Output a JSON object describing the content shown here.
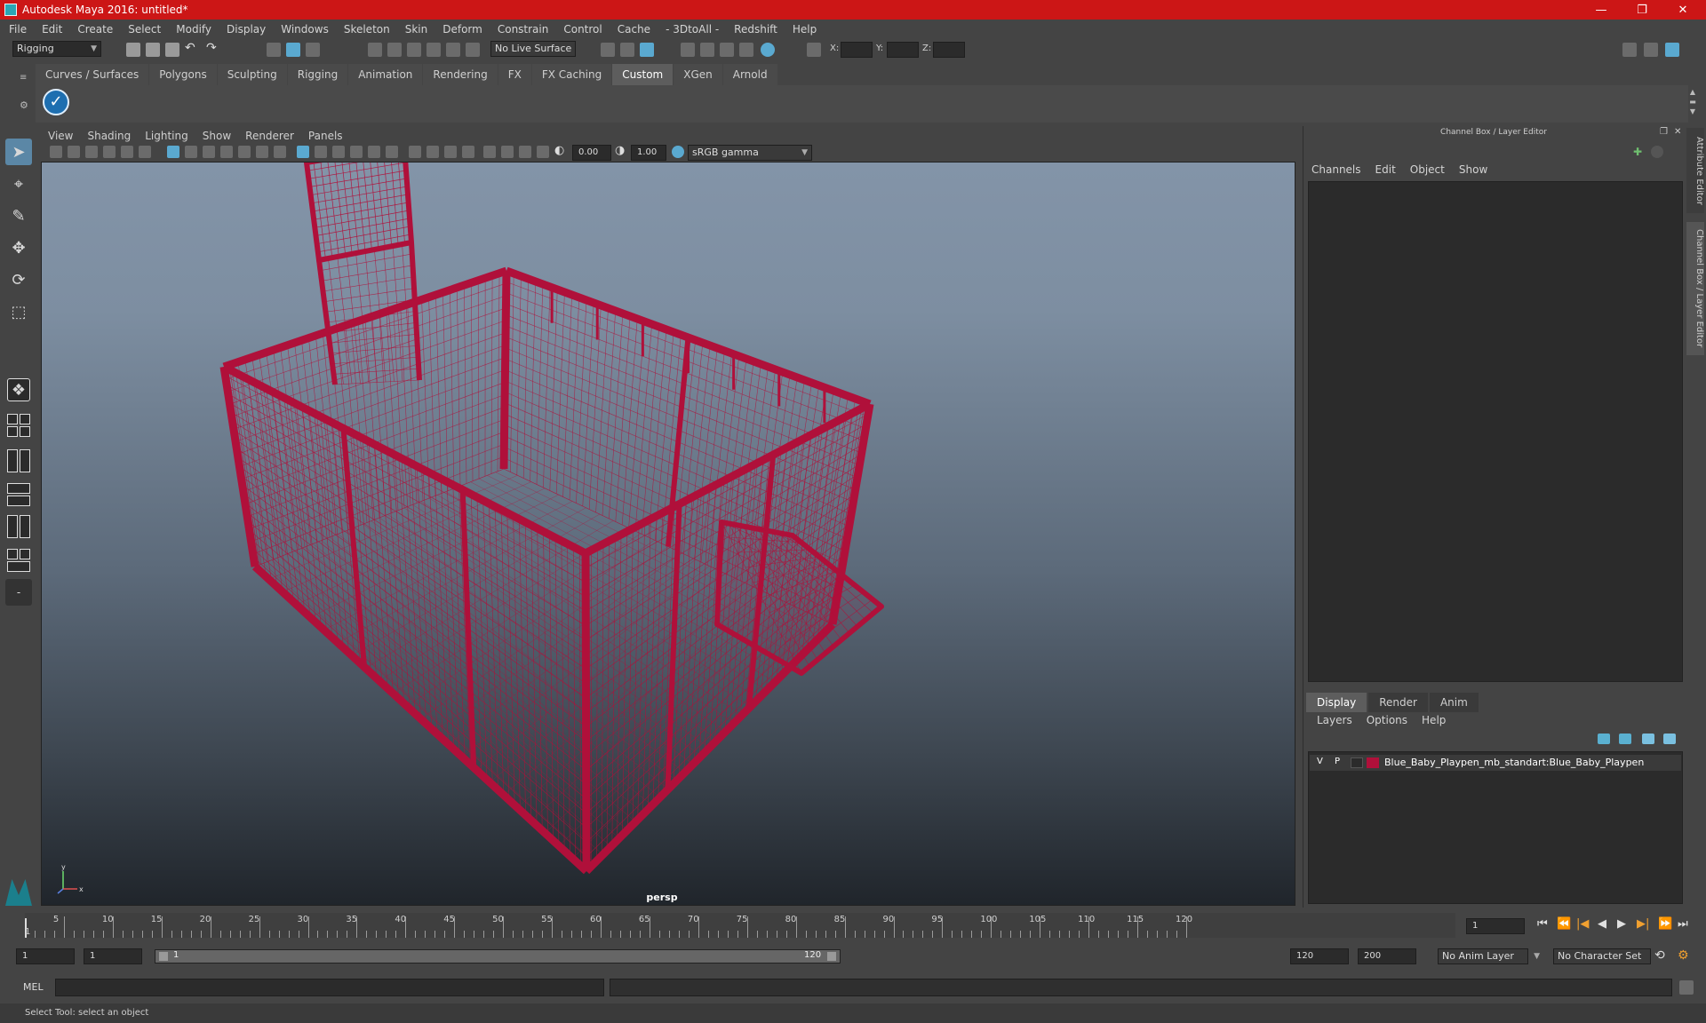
{
  "window": {
    "title": "Autodesk Maya 2016: untitled*",
    "minimize": "—",
    "maximize": "❐",
    "close": "✕"
  },
  "menubar": [
    "File",
    "Edit",
    "Create",
    "Select",
    "Modify",
    "Display",
    "Windows",
    "Skeleton",
    "Skin",
    "Deform",
    "Constrain",
    "Control",
    "Cache",
    "- 3DtoAll -",
    "Redshift",
    "Help"
  ],
  "statusline": {
    "menuset": "Rigging",
    "live_surface": "No Live Surface",
    "x_label": "X:",
    "y_label": "Y:",
    "z_label": "Z:"
  },
  "shelf": {
    "tabs": [
      "Curves / Surfaces",
      "Polygons",
      "Sculpting",
      "Rigging",
      "Animation",
      "Rendering",
      "FX",
      "FX Caching",
      "Custom",
      "XGen",
      "Arnold"
    ],
    "active_tab": "Custom",
    "button_icon": "checkmark-icon"
  },
  "viewport": {
    "menu": [
      "View",
      "Shading",
      "Lighting",
      "Show",
      "Renderer",
      "Panels"
    ],
    "exposure": "0.00",
    "gamma": "1.00",
    "color_space": "sRGB gamma",
    "camera": "persp",
    "wire_color": "#b0103a",
    "axis_x": "x",
    "axis_y": "y"
  },
  "right_panel": {
    "title": "Channel Box / Layer Editor",
    "side_tabs": [
      "Attribute Editor",
      "Channel Box / Layer Editor"
    ],
    "channel_menu": [
      "Channels",
      "Edit",
      "Object",
      "Show"
    ],
    "layer_tabs": [
      "Display",
      "Render",
      "Anim"
    ],
    "active_layer_tab": "Display",
    "layer_menu": [
      "Layers",
      "Options",
      "Help"
    ],
    "layer": {
      "visible": "V",
      "playback": "P",
      "color": "#b0103a",
      "name": "Blue_Baby_Playpen_mb_standart:Blue_Baby_Playpen"
    }
  },
  "timeline": {
    "ticks": [
      "5",
      "10",
      "15",
      "20",
      "25",
      "30",
      "35",
      "40",
      "45",
      "50",
      "55",
      "60",
      "65",
      "70",
      "75",
      "80",
      "85",
      "90",
      "95",
      "100",
      "105",
      "110",
      "115",
      "120"
    ],
    "current_marker": "1",
    "current_frame": "1"
  },
  "range": {
    "start": "1",
    "playback_start": "1",
    "slider_start": "1",
    "slider_end": "120",
    "playback_end": "120",
    "end": "200",
    "anim_layer": "No Anim Layer",
    "character_set": "No Character Set"
  },
  "command": {
    "language": "MEL"
  },
  "help_line": "Select Tool: select an object"
}
